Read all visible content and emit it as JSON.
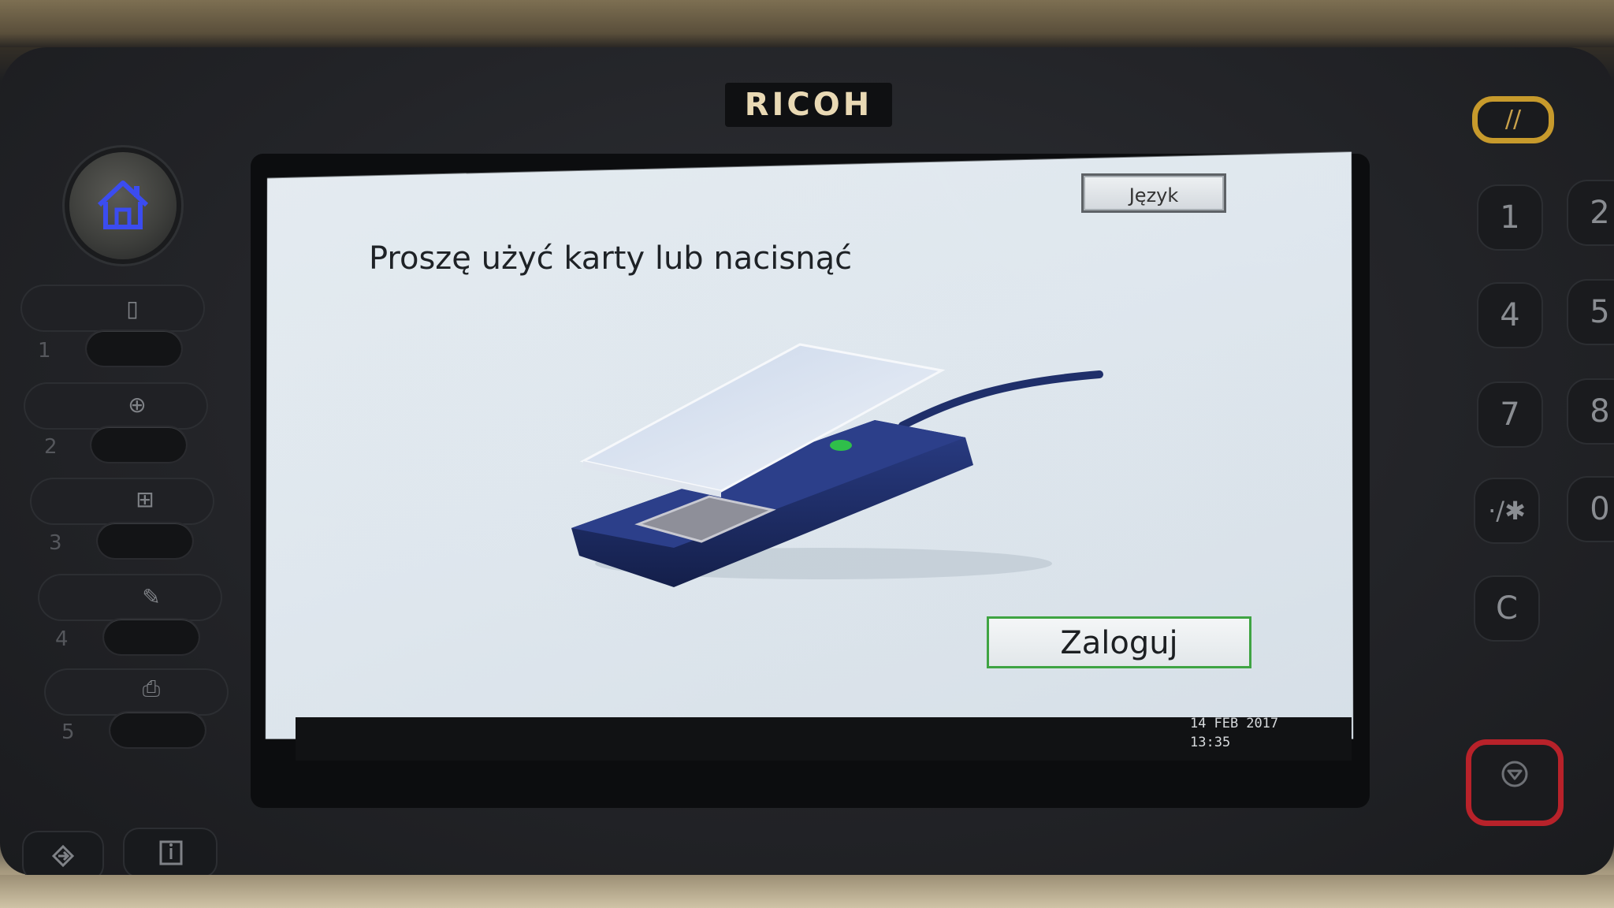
{
  "device": {
    "brand": "RICOH"
  },
  "screen": {
    "language_button": "Język",
    "prompt": "Proszę użyć karty lub nacisnąć",
    "login_button": "Zaloguj",
    "date": {
      "day": "14",
      "month": "FEB",
      "year": "2017"
    },
    "time": "13:35",
    "illustration": "card-reader-icon"
  },
  "left_panel": {
    "home_icon": "home-icon",
    "function_keys": [
      {
        "glyph": "▯",
        "number": "1"
      },
      {
        "glyph": "⊕",
        "number": "2"
      },
      {
        "glyph": "⊞",
        "number": "3"
      },
      {
        "glyph": "✎",
        "number": "4"
      },
      {
        "glyph": "⎙",
        "number": "5"
      }
    ]
  },
  "right_panel": {
    "keypad": [
      "1",
      "2",
      "4",
      "5",
      "7",
      "8",
      "·/✱",
      "0",
      "C"
    ],
    "reset_glyph": "//",
    "stop_icon": "stop-icon"
  },
  "bottom_panel": {
    "login_icon": "login-icon",
    "info_icon": "info-icon"
  },
  "colors": {
    "home_accent": "#3b4cf0",
    "reset_accent": "#c79a2c",
    "stop_accent": "#b8222a",
    "login_border": "#3fa443",
    "reader_body": "#1f2f6a"
  }
}
